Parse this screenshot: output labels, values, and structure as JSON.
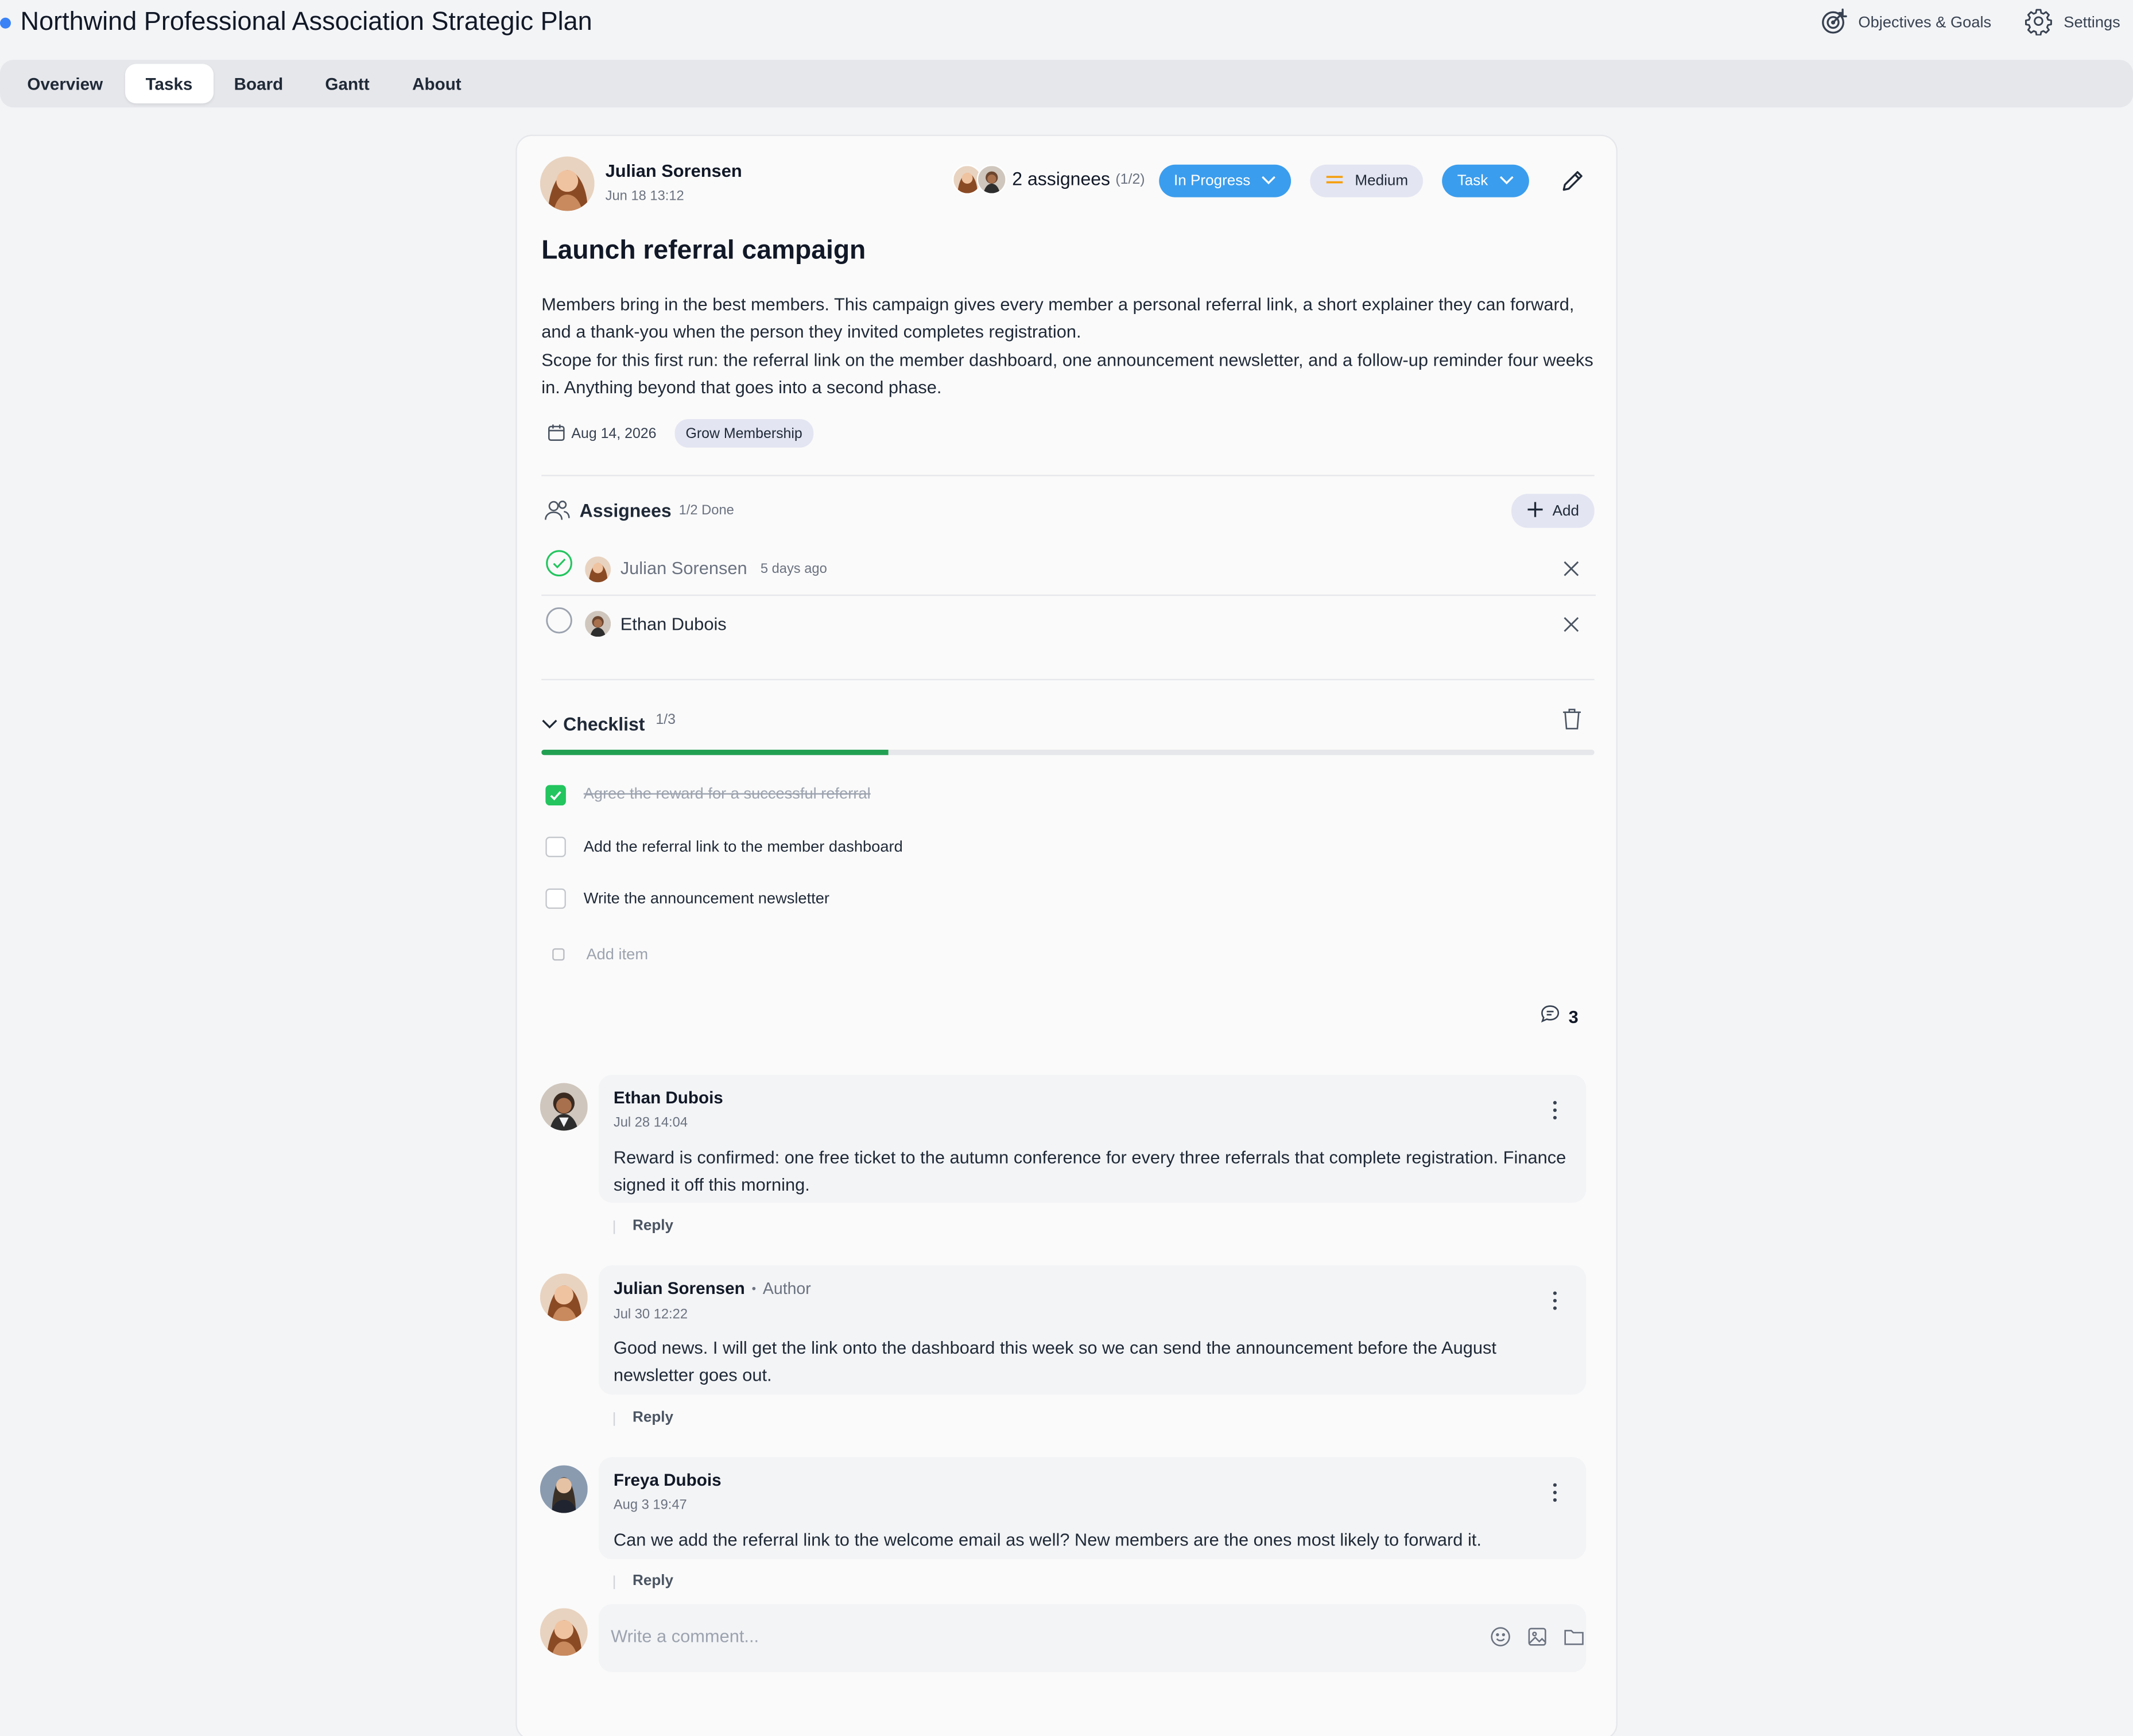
{
  "app": {
    "title": "Northwind Professional Association Strategic Plan"
  },
  "top_actions": {
    "objectives_label": "Objectives & Goals",
    "settings_label": "Settings"
  },
  "tabs": [
    {
      "label": "Overview"
    },
    {
      "label": "Tasks"
    },
    {
      "label": "Board"
    },
    {
      "label": "Gantt"
    },
    {
      "label": "About"
    }
  ],
  "active_tab": "Tasks",
  "task": {
    "author_name": "Julian Sorensen",
    "created": "Jun 18 13:12",
    "assignees_summary": "2 assignees",
    "assignees_ratio": "(1/2)",
    "status": "In Progress",
    "priority": "Medium",
    "type": "Task",
    "title": "Launch referral campaign",
    "description_1": "Members bring in the best members. This campaign gives every member a personal referral link, a short explainer they can forward, and a thank-you when the person they invited completes registration.",
    "description_2": "Scope for this first run: the referral link on the member dashboard, one announcement newsletter, and a follow-up reminder four weeks in. Anything beyond that goes into a second phase.",
    "due_date": "Aug 14, 2026",
    "objective_tag": "Grow Membership"
  },
  "assignees": {
    "heading": "Assignees",
    "done_count": "1/2 Done",
    "add_label": "Add",
    "list": [
      {
        "name": "Julian Sorensen",
        "when": "5 days ago",
        "done": true
      },
      {
        "name": "Ethan Dubois",
        "when": "",
        "done": false
      }
    ]
  },
  "checklist": {
    "heading": "Checklist",
    "count": "1/3",
    "progress": 0.33,
    "items": [
      {
        "text": "Agree the reward for a successful referral",
        "done": true
      },
      {
        "text": "Add the referral link to the member dashboard",
        "done": false
      },
      {
        "text": "Write the announcement newsletter",
        "done": false
      }
    ],
    "add_placeholder": "Add item"
  },
  "comments_count": "3",
  "comments": [
    {
      "author": "Ethan Dubois",
      "role": "",
      "time": "Jul 28 14:04",
      "body": "Reward is confirmed: one free ticket to the autumn conference for every three referrals that complete registration. Finance signed it off this morning.",
      "reply_label": "Reply"
    },
    {
      "author": "Julian Sorensen",
      "role": "Author",
      "time": "Jul 30 12:22",
      "body": "Good news. I will get the link onto the dashboard this week so we can send the announcement before the August newsletter goes out.",
      "reply_label": "Reply"
    },
    {
      "author": "Freya Dubois",
      "role": "",
      "time": "Aug 3 19:47",
      "body": "Can we add the referral link to the welcome email as well? New members are the ones most likely to forward it.",
      "reply_label": "Reply"
    }
  ],
  "composer": {
    "placeholder": "Write a comment..."
  },
  "colors": {
    "accent": "#3b9ded",
    "success": "#22c55e",
    "priority": "#f59e0b",
    "progress": "#22a052"
  }
}
